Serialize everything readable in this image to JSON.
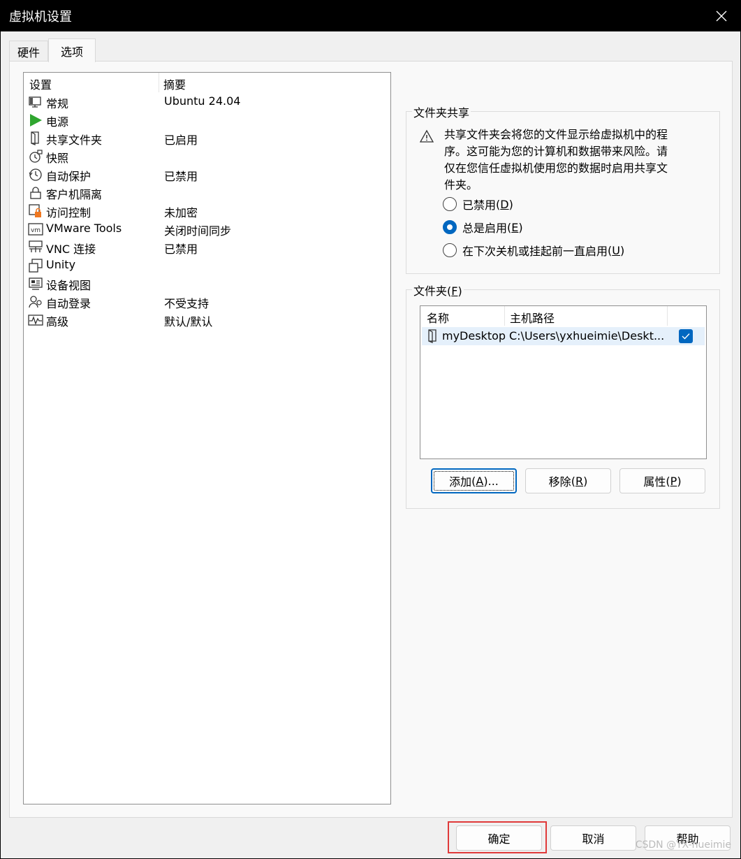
{
  "window": {
    "title": "虚拟机设置"
  },
  "tabs": [
    {
      "label": "硬件"
    },
    {
      "label": "选项"
    }
  ],
  "settings_list": {
    "columns": [
      "设置",
      "摘要"
    ],
    "rows": [
      {
        "name": "常规",
        "summary": "Ubuntu 24.04",
        "icon": "monitor-icon"
      },
      {
        "name": "电源",
        "summary": "",
        "icon": "power-play-icon"
      },
      {
        "name": "共享文件夹",
        "summary": "已启用",
        "icon": "shared-folder-icon"
      },
      {
        "name": "快照",
        "summary": "",
        "icon": "snapshot-icon"
      },
      {
        "name": "自动保护",
        "summary": "已禁用",
        "icon": "clock-icon"
      },
      {
        "name": "客户机隔离",
        "summary": "",
        "icon": "lock-icon"
      },
      {
        "name": "访问控制",
        "summary": "未加密",
        "icon": "access-lock-icon"
      },
      {
        "name": "VMware Tools",
        "summary": "关闭时间同步",
        "icon": "vm-icon"
      },
      {
        "name": "VNC 连接",
        "summary": "已禁用",
        "icon": "vnc-icon"
      },
      {
        "name": "Unity",
        "summary": "",
        "icon": "unity-icon"
      },
      {
        "name": "设备视图",
        "summary": "",
        "icon": "device-view-icon"
      },
      {
        "name": "自动登录",
        "summary": "不受支持",
        "icon": "users-icon"
      },
      {
        "name": "高级",
        "summary": "默认/默认",
        "icon": "pulse-icon"
      }
    ]
  },
  "folder_sharing": {
    "title": "文件夹共享",
    "warning": "共享文件夹会将您的文件显示给虚拟机中的程序。这可能为您的计算机和数据带来风险。请仅在您信任虚拟机使用您的数据时启用共享文件夹。",
    "options": [
      {
        "label": "已禁用",
        "key": "D",
        "checked": false
      },
      {
        "label": "总是启用",
        "key": "E",
        "checked": true
      },
      {
        "label": "在下次关机或挂起前一直启用",
        "key": "U",
        "checked": false
      }
    ]
  },
  "folders": {
    "title": "文件夹",
    "key": "F",
    "columns": [
      "名称",
      "主机路径"
    ],
    "rows": [
      {
        "name": "myDesktop",
        "path": "C:\\Users\\yxhueimie\\Deskt...",
        "enabled": true
      }
    ],
    "buttons": {
      "add": "添加",
      "add_key": "A",
      "remove": "移除",
      "remove_key": "R",
      "properties": "属性",
      "properties_key": "P"
    }
  },
  "footer": {
    "ok": "确定",
    "cancel": "取消",
    "help": "帮助"
  },
  "watermark": "CSDN @YX-hueimie"
}
